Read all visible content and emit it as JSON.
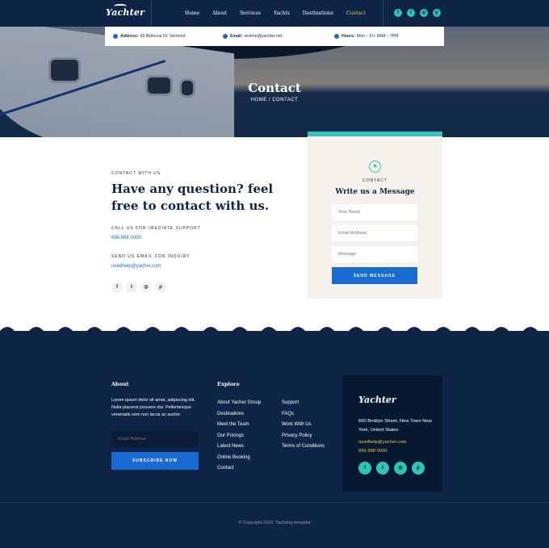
{
  "header": {
    "logo": "Yachter",
    "nav": [
      {
        "label": "Home"
      },
      {
        "label": "About"
      },
      {
        "label": "Services"
      },
      {
        "label": "Yachts"
      },
      {
        "label": "Destinations"
      },
      {
        "label": "Contact"
      }
    ],
    "social": [
      {
        "icon": "facebook-icon",
        "glyph": "f"
      },
      {
        "icon": "twitter-icon",
        "glyph": "t"
      },
      {
        "icon": "instagram-icon",
        "glyph": "◎"
      },
      {
        "icon": "pinterest-icon",
        "glyph": "p"
      }
    ]
  },
  "infobar": {
    "address_label": "Address:",
    "address": "66 Bellevue Dr, Vermont",
    "email_label": "Email:",
    "email": "rentme@yachter.net",
    "hours_label": "Hours:",
    "hours": "Mon – Fri: 9AM – 7PM"
  },
  "hero": {
    "title": "Contact",
    "breadcrumb_home": "HOME",
    "breadcrumb_sep": " / ",
    "breadcrumb_current": "CONTACT"
  },
  "contact": {
    "kicker": "CONTACT WITH US",
    "heading": "Have any question? feel free to contact with us.",
    "call_kicker": "CALL US FOR IMEDIATE SUPPORT",
    "call_value": "666 888 0000",
    "mail_kicker": "SEND US EMAIL FOR INQUIRY",
    "mail_value": "needhelp@yacher.com",
    "social": [
      {
        "icon": "facebook-icon",
        "glyph": "f"
      },
      {
        "icon": "twitter-icon",
        "glyph": "t"
      },
      {
        "icon": "instagram-icon",
        "glyph": "◎"
      },
      {
        "icon": "pinterest-icon",
        "glyph": "p"
      }
    ]
  },
  "form": {
    "kicker": "CONTACT",
    "heading": "Write us a Message",
    "name_placeholder": "Your Name",
    "email_placeholder": "Email Address",
    "message_placeholder": "Message",
    "send_label": "SEND MESSAGE"
  },
  "footer": {
    "about_heading": "About",
    "about_text": "Lorem ipsum dolor sit amet, adipiscing elit. Nulla placerat posuere dui. Pellentesque venenatis sem non lacus ac auctor.",
    "email_placeholder": "Email Address",
    "subscribe_label": "SUBSCRIBE NOW",
    "explore_heading": "Explore",
    "explore_col1": [
      "About Yacher Group",
      "Destinations",
      "Meet the Team",
      "Our Pricings",
      "Latest News",
      "Online Booking",
      "Contact"
    ],
    "explore_col2": [
      "Support",
      "FAQs",
      "Work With Us",
      "Privacy Policy",
      "Terms of Conditions"
    ],
    "box_logo": "Yachter",
    "box_address": "660 Broklyn Street, New Town New York, United States",
    "box_email": "needhelp@yacher.com",
    "box_phone": "666 888 0000",
    "box_social": [
      {
        "icon": "facebook-icon",
        "glyph": "f"
      },
      {
        "icon": "twitter-icon",
        "glyph": "t"
      },
      {
        "icon": "instagram-icon",
        "glyph": "◎"
      },
      {
        "icon": "pinterest-icon",
        "glyph": "p"
      }
    ],
    "copyright": "© Copyright 2020. Yachting template"
  },
  "colors": {
    "navy": "#0f2547",
    "teal": "#2ec4b6",
    "blue": "#1a6ad4",
    "gold": "#e8c63a"
  }
}
